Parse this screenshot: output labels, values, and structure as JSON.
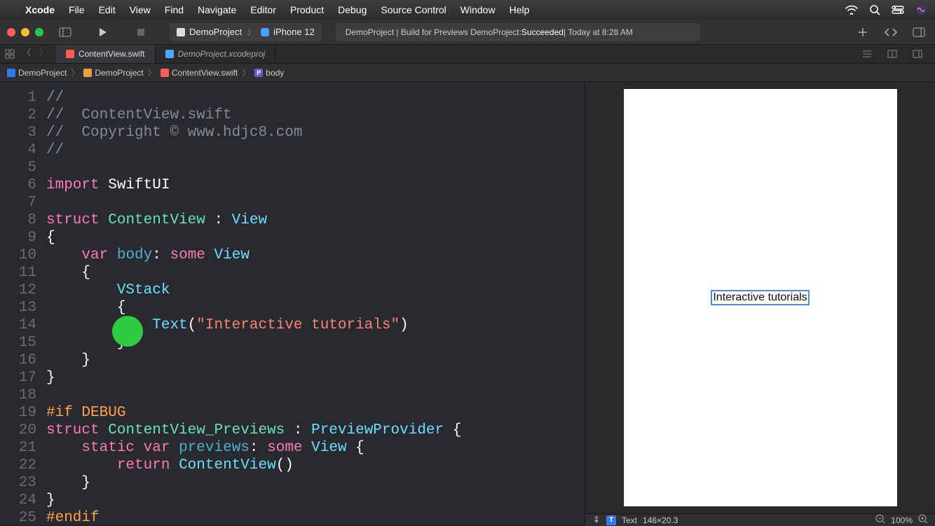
{
  "menubar": {
    "app": "Xcode",
    "items": [
      "File",
      "Edit",
      "View",
      "Find",
      "Navigate",
      "Editor",
      "Product",
      "Debug",
      "Source Control",
      "Window",
      "Help"
    ]
  },
  "toolbar": {
    "scheme_project": "DemoProject",
    "scheme_device": "iPhone 12",
    "status_prefix": "DemoProject | Build for Previews DemoProject: ",
    "status_result": "Succeeded",
    "status_time": " | Today at 8:28 AM"
  },
  "tabs": [
    {
      "name": "ContentView.swift",
      "active": true,
      "kind": "swift"
    },
    {
      "name": "DemoProject.xcodeproj",
      "active": false,
      "kind": "proj"
    }
  ],
  "breadcrumb": [
    {
      "icon": "folder-blue",
      "label": "DemoProject"
    },
    {
      "icon": "folder-yellow",
      "label": "DemoProject"
    },
    {
      "icon": "swift",
      "label": "ContentView.swift"
    },
    {
      "icon": "prop",
      "label": "body"
    }
  ],
  "code": {
    "lines": [
      {
        "n": 1,
        "tokens": [
          {
            "c": "c-comment",
            "t": "//"
          }
        ]
      },
      {
        "n": 2,
        "tokens": [
          {
            "c": "c-comment",
            "t": "//  ContentView.swift"
          }
        ]
      },
      {
        "n": 3,
        "tokens": [
          {
            "c": "c-comment",
            "t": "//  Copyright © www.hdjc8.com"
          }
        ]
      },
      {
        "n": 4,
        "tokens": [
          {
            "c": "c-comment",
            "t": "//"
          }
        ]
      },
      {
        "n": 5,
        "tokens": []
      },
      {
        "n": 6,
        "tokens": [
          {
            "c": "c-keyword",
            "t": "import"
          },
          {
            "c": "c-plain",
            "t": " SwiftUI"
          }
        ]
      },
      {
        "n": 7,
        "tokens": []
      },
      {
        "n": 8,
        "tokens": [
          {
            "c": "c-keyword",
            "t": "struct"
          },
          {
            "c": "c-plain",
            "t": " "
          },
          {
            "c": "c-teal",
            "t": "ContentView"
          },
          {
            "c": "c-plain",
            "t": " : "
          },
          {
            "c": "c-type",
            "t": "View"
          }
        ]
      },
      {
        "n": 9,
        "tokens": [
          {
            "c": "c-plain",
            "t": "{"
          }
        ]
      },
      {
        "n": 10,
        "tokens": [
          {
            "c": "c-plain",
            "t": "    "
          },
          {
            "c": "c-keyword",
            "t": "var"
          },
          {
            "c": "c-plain",
            "t": " "
          },
          {
            "c": "c-ident",
            "t": "body"
          },
          {
            "c": "c-plain",
            "t": ": "
          },
          {
            "c": "c-keyword",
            "t": "some"
          },
          {
            "c": "c-plain",
            "t": " "
          },
          {
            "c": "c-type",
            "t": "View"
          }
        ]
      },
      {
        "n": 11,
        "tokens": [
          {
            "c": "c-plain",
            "t": "    {"
          }
        ]
      },
      {
        "n": 12,
        "tokens": [
          {
            "c": "c-plain",
            "t": "        "
          },
          {
            "c": "c-type",
            "t": "VStack"
          }
        ]
      },
      {
        "n": 13,
        "tokens": [
          {
            "c": "c-plain",
            "t": "        {"
          }
        ]
      },
      {
        "n": 14,
        "tokens": [
          {
            "c": "c-plain",
            "t": "            "
          },
          {
            "c": "c-type",
            "t": "Text"
          },
          {
            "c": "c-plain",
            "t": "("
          },
          {
            "c": "c-string",
            "t": "\"Interactive tutorials\""
          },
          {
            "c": "c-plain",
            "t": ")"
          }
        ]
      },
      {
        "n": 15,
        "tokens": [
          {
            "c": "c-plain",
            "t": "        }"
          }
        ]
      },
      {
        "n": 16,
        "tokens": [
          {
            "c": "c-plain",
            "t": "    }"
          }
        ]
      },
      {
        "n": 17,
        "tokens": [
          {
            "c": "c-plain",
            "t": "}"
          }
        ]
      },
      {
        "n": 18,
        "tokens": []
      },
      {
        "n": 19,
        "tokens": [
          {
            "c": "c-attr",
            "t": "#if DEBUG"
          }
        ]
      },
      {
        "n": 20,
        "tokens": [
          {
            "c": "c-keyword",
            "t": "struct"
          },
          {
            "c": "c-plain",
            "t": " "
          },
          {
            "c": "c-teal",
            "t": "ContentView_Previews"
          },
          {
            "c": "c-plain",
            "t": " : "
          },
          {
            "c": "c-type",
            "t": "PreviewProvider"
          },
          {
            "c": "c-plain",
            "t": " {"
          }
        ]
      },
      {
        "n": 21,
        "tokens": [
          {
            "c": "c-plain",
            "t": "    "
          },
          {
            "c": "c-keyword",
            "t": "static"
          },
          {
            "c": "c-plain",
            "t": " "
          },
          {
            "c": "c-keyword",
            "t": "var"
          },
          {
            "c": "c-plain",
            "t": " "
          },
          {
            "c": "c-ident",
            "t": "previews"
          },
          {
            "c": "c-plain",
            "t": ": "
          },
          {
            "c": "c-keyword",
            "t": "some"
          },
          {
            "c": "c-plain",
            "t": " "
          },
          {
            "c": "c-type",
            "t": "View"
          },
          {
            "c": "c-plain",
            "t": " {"
          }
        ]
      },
      {
        "n": 22,
        "tokens": [
          {
            "c": "c-plain",
            "t": "        "
          },
          {
            "c": "c-keyword",
            "t": "return"
          },
          {
            "c": "c-plain",
            "t": " "
          },
          {
            "c": "c-type",
            "t": "ContentView"
          },
          {
            "c": "c-plain",
            "t": "()"
          }
        ]
      },
      {
        "n": 23,
        "tokens": [
          {
            "c": "c-plain",
            "t": "    }"
          }
        ]
      },
      {
        "n": 24,
        "tokens": [
          {
            "c": "c-plain",
            "t": "}"
          }
        ]
      },
      {
        "n": 25,
        "tokens": [
          {
            "c": "c-attr",
            "t": "#endif"
          }
        ]
      }
    ]
  },
  "preview": {
    "text": "Interactive tutorials",
    "selected_element": "Text",
    "dimensions": "146×20.3",
    "zoom": "100%"
  }
}
